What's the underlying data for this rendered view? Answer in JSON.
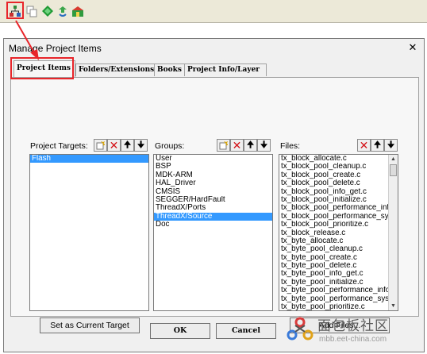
{
  "toolbar": {
    "icons": [
      "manage-project-items-icon",
      "copy-icon",
      "diamond-icon",
      "rebuild-icon",
      "pack-installer-icon"
    ]
  },
  "dialog": {
    "title": "Manage Project Items",
    "close_label": "✕",
    "tabs": [
      {
        "label": "Project Items"
      },
      {
        "label": "Folders/Extensions"
      },
      {
        "label": "Books"
      },
      {
        "label": "Project Info/Layer"
      }
    ],
    "targets": {
      "label": "Project Targets:",
      "items": [
        "Flash"
      ]
    },
    "groups": {
      "label": "Groups:",
      "items": [
        "User",
        "BSP",
        "MDK-ARM",
        "HAL_Driver",
        "CMSIS",
        "SEGGER/HardFault",
        "ThreadX/Ports",
        "ThreadX/Source",
        "Doc"
      ]
    },
    "files": {
      "label": "Files:",
      "items": [
        "tx_block_allocate.c",
        "tx_block_pool_cleanup.c",
        "tx_block_pool_create.c",
        "tx_block_pool_delete.c",
        "tx_block_pool_info_get.c",
        "tx_block_pool_initialize.c",
        "tx_block_pool_performance_info_g",
        "tx_block_pool_performance_syster",
        "tx_block_pool_prioritize.c",
        "tx_block_release.c",
        "tx_byte_allocate.c",
        "tx_byte_pool_cleanup.c",
        "tx_byte_pool_create.c",
        "tx_byte_pool_delete.c",
        "tx_byte_pool_info_get.c",
        "tx_byte_pool_initialize.c",
        "tx_byte_pool_performance_info_ge",
        "tx_byte_pool_performance_system",
        "tx_byte_pool_prioritize.c"
      ]
    },
    "buttons": {
      "set_current_target": "Set as Current Target",
      "add_files": "Add Files...",
      "ok": "OK",
      "cancel": "Cancel"
    }
  },
  "watermark": {
    "brand": "面包板社区",
    "url": "mbb.eet-china.com"
  },
  "colors": {
    "highlight_red": "#e8252a",
    "selection_blue": "#3399ff"
  }
}
